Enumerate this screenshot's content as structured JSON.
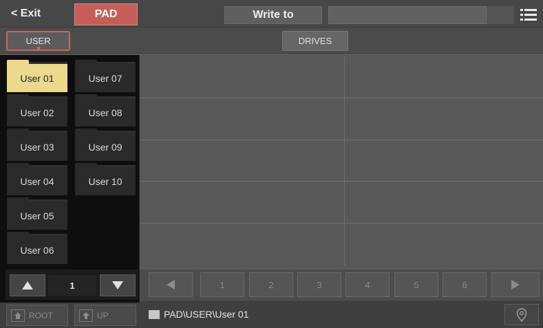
{
  "topbar": {
    "exit_label": "< Exit",
    "pad_label": "PAD",
    "write_to_label": "Write to",
    "name_value": ""
  },
  "tabs": [
    {
      "label": "USER",
      "active": true
    },
    {
      "label": "DRIVES",
      "active": false
    }
  ],
  "folders": [
    {
      "label": "User 01",
      "selected": true
    },
    {
      "label": "User 02",
      "selected": false
    },
    {
      "label": "User 03",
      "selected": false
    },
    {
      "label": "User 04",
      "selected": false
    },
    {
      "label": "User 05",
      "selected": false
    },
    {
      "label": "User 06",
      "selected": false
    },
    {
      "label": "User 07",
      "selected": false
    },
    {
      "label": "User 08",
      "selected": false
    },
    {
      "label": "User 09",
      "selected": false
    },
    {
      "label": "User 10",
      "selected": false
    }
  ],
  "popup_nav": {
    "page": "1"
  },
  "pager": {
    "pages": [
      "1",
      "2",
      "3",
      "4",
      "5",
      "6"
    ]
  },
  "footer": {
    "root_label": "ROOT",
    "up_label": "UP",
    "path": "PAD\\USER\\User 01"
  },
  "colors": {
    "pad_accent": "#c65e58",
    "selected_folder": "#ecd98e",
    "tab_outline": "#c66a5c"
  },
  "icons": {
    "menu": "list-menu-icon",
    "arrow_up": "triangle-up-icon",
    "arrow_down": "triangle-down-icon",
    "prev": "triangle-left-icon",
    "next": "triangle-right-icon",
    "root": "home-folder-icon",
    "up": "up-arrow-folder-icon",
    "path": "folder-icon",
    "locate": "location-pin-icon"
  }
}
